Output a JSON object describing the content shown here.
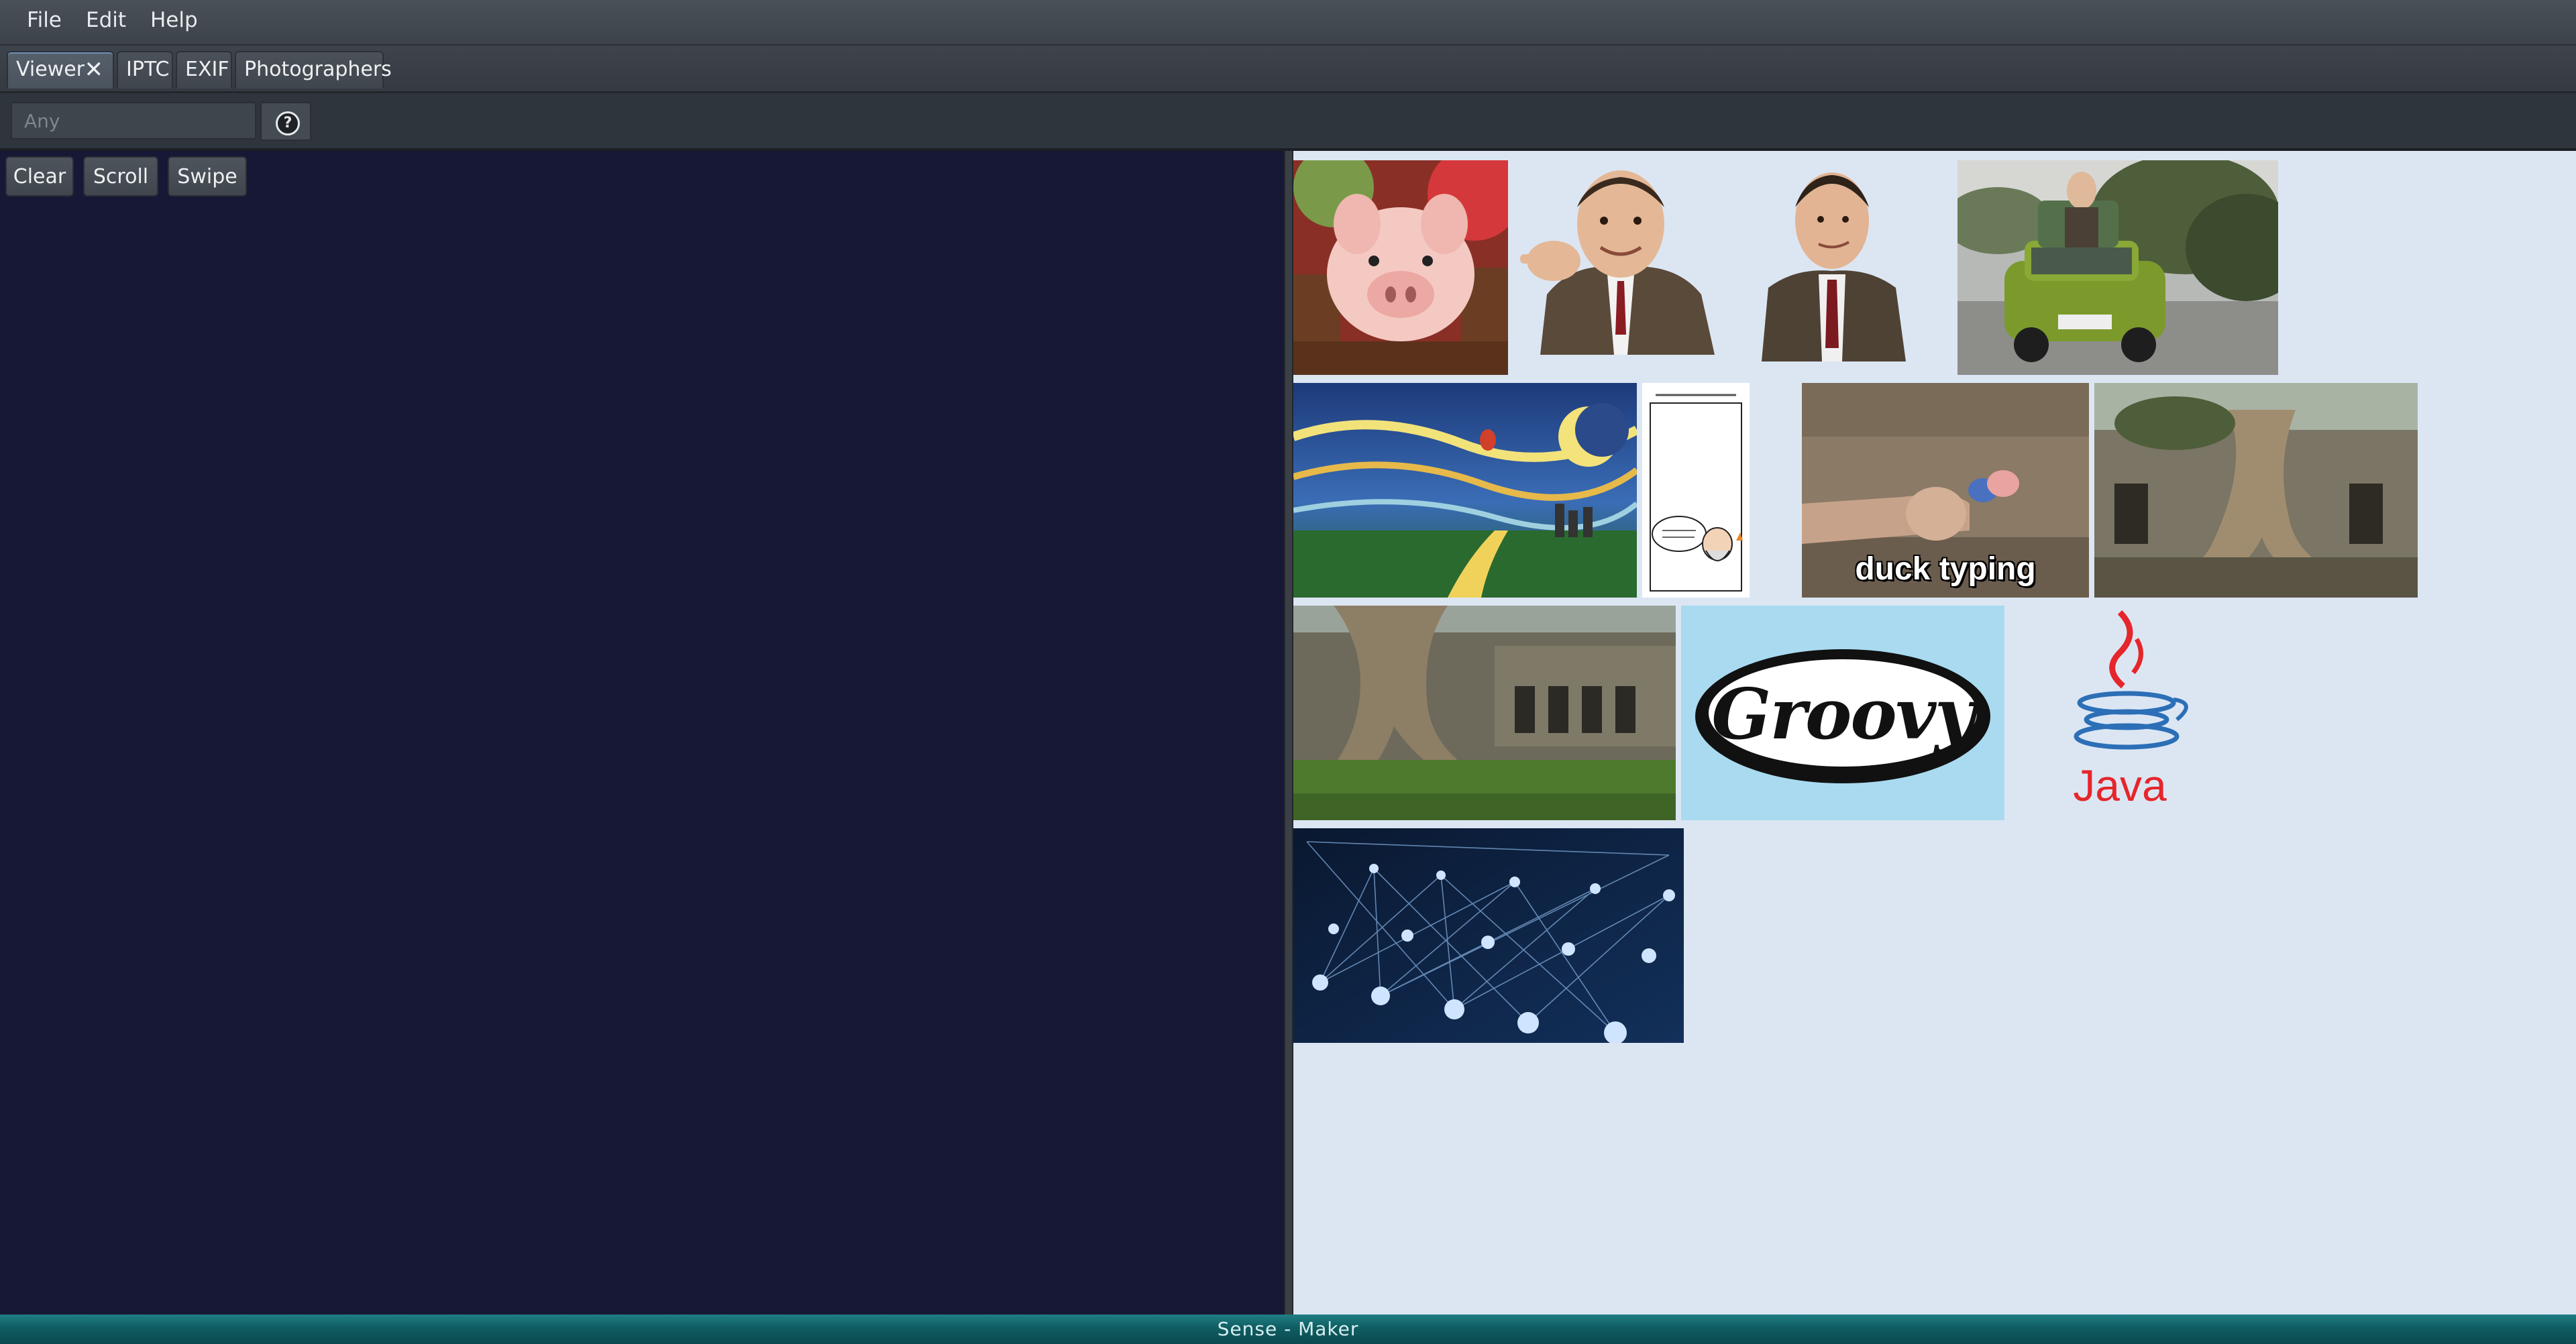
{
  "menu": {
    "items": [
      "File",
      "Edit",
      "Help"
    ]
  },
  "tabs": [
    {
      "label": "Viewer",
      "active": true,
      "closable": true
    },
    {
      "label": "IPTC"
    },
    {
      "label": "EXIF"
    },
    {
      "label": "Photographers"
    }
  ],
  "toolbar": {
    "search_placeholder": "Any",
    "help_icon": "question-icon"
  },
  "viewer": {
    "buttons": [
      "Clear",
      "Scroll",
      "Swipe"
    ]
  },
  "gallery": {
    "thumbnails": [
      {
        "subject": "piglet"
      },
      {
        "subject": "man-pointing"
      },
      {
        "subject": "man-in-suit"
      },
      {
        "subject": "armchair-on-car-roof"
      },
      {
        "subject": "starry-night-painting"
      },
      {
        "subject": "comic-strip"
      },
      {
        "subject": "duck-typing-meme",
        "caption": "duck typing"
      },
      {
        "subject": "temple-tree-roots"
      },
      {
        "subject": "temple-ruins"
      },
      {
        "subject": "groovy-logo",
        "caption": "Groovy"
      },
      {
        "subject": "java-logo",
        "caption": "Java"
      },
      {
        "subject": "neural-network"
      }
    ]
  },
  "status": {
    "text": "Sense - Maker"
  },
  "colors": {
    "viewer_bg": "#171836",
    "gallery_bg": "#dce6f3",
    "status_bar": "#0f5d62",
    "java_red": "#e5262b",
    "java_blue": "#2c6fb7"
  }
}
